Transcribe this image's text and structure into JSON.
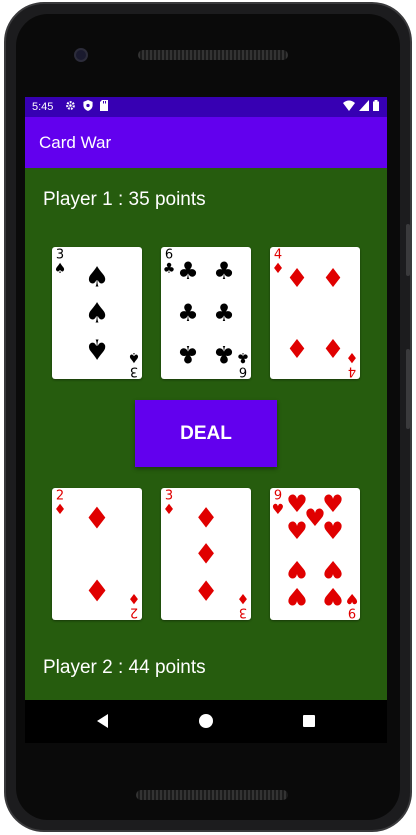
{
  "status": {
    "time": "5:45"
  },
  "app": {
    "title": "Card War"
  },
  "player1": {
    "label": "Player 1 : 35 points"
  },
  "player2": {
    "label": "Player 2 : 44 points"
  },
  "deal_button": {
    "label": "DEAL"
  },
  "cards": {
    "player1": [
      {
        "rank": "3",
        "suit": "spades",
        "symbol": "♠",
        "color": "#000000"
      },
      {
        "rank": "6",
        "suit": "clubs",
        "symbol": "♣",
        "color": "#000000"
      },
      {
        "rank": "4",
        "suit": "diamonds",
        "symbol": "♦",
        "color": "#e00000"
      }
    ],
    "player2": [
      {
        "rank": "2",
        "suit": "diamonds",
        "symbol": "♦",
        "color": "#e00000"
      },
      {
        "rank": "3",
        "suit": "diamonds",
        "symbol": "♦",
        "color": "#e00000"
      },
      {
        "rank": "9",
        "suit": "hearts",
        "symbol": "♥",
        "color": "#e00000"
      }
    ]
  },
  "colors": {
    "table_green": "#265c0e",
    "appbar_purple": "#6200ee",
    "statusbar_purple": "#3700b3",
    "card_red": "#e00000"
  }
}
